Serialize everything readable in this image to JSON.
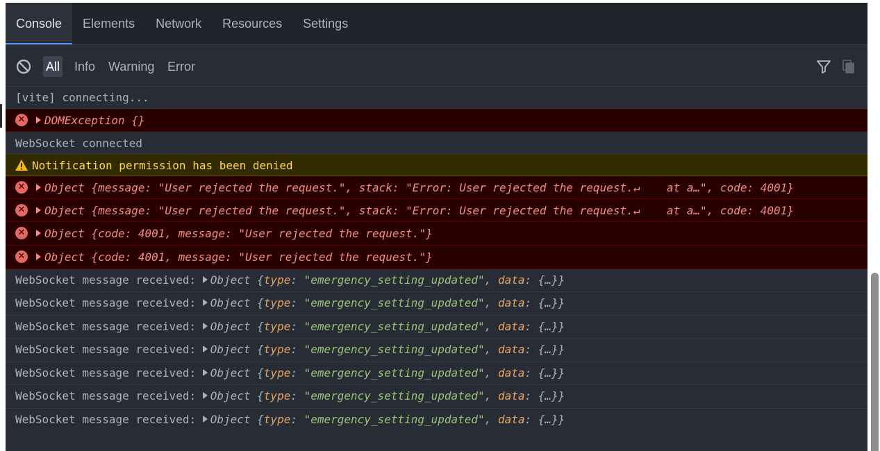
{
  "tabs": [
    {
      "label": "Console"
    },
    {
      "label": "Elements"
    },
    {
      "label": "Network"
    },
    {
      "label": "Resources"
    },
    {
      "label": "Settings"
    }
  ],
  "filter": {
    "levels": [
      "All",
      "Info",
      "Warning",
      "Error"
    ],
    "selected": "All",
    "icons": {
      "clear": "clear-console-icon",
      "filter": "filter-icon",
      "copy": "copy-icon"
    }
  },
  "log": {
    "vite": "[vite] connecting...",
    "dom_exception": "DOMException {}",
    "ws_connected": "WebSocket connected",
    "notif_warning": "Notification permission has been denied",
    "err_obj_long": "Object {message: \"User rejected the request.\", stack: \"Error: User rejected the request.↵    at a…\", code: 4001}",
    "err_obj_short": "Object {code: 4001, message: \"User rejected the request.\"}",
    "ws_prefix": "WebSocket message received: ",
    "ws_obj": "Object ",
    "ws_open": "{",
    "ws_type_key": "type",
    "ws_colon": ": ",
    "ws_type_val": "\"emergency_setting_updated\"",
    "ws_sep": ", ",
    "ws_data_key": "data",
    "ws_data_val": "{…}",
    "ws_close": "}"
  },
  "colors": {
    "panel_bg": "#282c34",
    "error_bg": "#290000",
    "error_text": "#f28b82",
    "warning_bg": "#332b00",
    "warning_text": "#ffd54f",
    "accent": "#4d90fe"
  }
}
